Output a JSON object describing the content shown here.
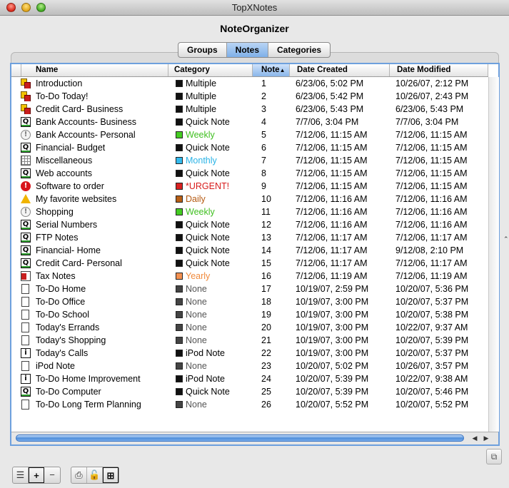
{
  "window": {
    "title": "TopXNotes"
  },
  "app": {
    "title": "NoteOrganizer"
  },
  "tabs": [
    {
      "label": "Groups",
      "active": false
    },
    {
      "label": "Notes",
      "active": true
    },
    {
      "label": "Categories",
      "active": false
    }
  ],
  "table": {
    "columns": {
      "name": "Name",
      "category": "Category",
      "note": "Note",
      "created": "Date Created",
      "modified": "Date Modified"
    },
    "sort_indicator": "▲",
    "rows": [
      {
        "icon": "multi-icon",
        "name": "Introduction",
        "category": "Multiple",
        "cat_color": "#000000",
        "swatch": "#111111",
        "note": "1",
        "created": "6/23/06, 5:02 PM",
        "modified": "10/26/07, 2:12 PM"
      },
      {
        "icon": "multi-icon",
        "name": "To-Do Today!",
        "category": "Multiple",
        "cat_color": "#000000",
        "swatch": "#111111",
        "note": "2",
        "created": "6/23/06, 5:42 PM",
        "modified": "10/26/07, 2:43 PM"
      },
      {
        "icon": "multi-icon",
        "name": "Credit Card- Business",
        "category": "Multiple",
        "cat_color": "#000000",
        "swatch": "#111111",
        "note": "3",
        "created": "6/23/06, 5:43 PM",
        "modified": "6/23/06, 5:43 PM"
      },
      {
        "icon": "quick-note-icon",
        "name": "Bank Accounts- Business",
        "category": "Quick Note",
        "cat_color": "#000000",
        "swatch": "#111111",
        "note": "4",
        "created": "7/7/06, 3:04 PM",
        "modified": "7/7/06, 3:04 PM"
      },
      {
        "icon": "weekly-alert-icon",
        "name": "Bank Accounts- Personal",
        "category": "Weekly",
        "cat_color": "#3fbf1f",
        "swatch": "#44cc22",
        "note": "5",
        "created": "7/12/06, 11:15 AM",
        "modified": "7/12/06, 11:15 AM"
      },
      {
        "icon": "quick-note-icon",
        "name": "Financial- Budget",
        "category": "Quick Note",
        "cat_color": "#000000",
        "swatch": "#111111",
        "note": "6",
        "created": "7/12/06, 11:15 AM",
        "modified": "7/12/06, 11:15 AM"
      },
      {
        "icon": "grid-icon",
        "name": "Miscellaneous",
        "category": "Monthly",
        "cat_color": "#2ab3e6",
        "swatch": "#33bbee",
        "note": "7",
        "created": "7/12/06, 11:15 AM",
        "modified": "7/12/06, 11:15 AM"
      },
      {
        "icon": "quick-note-icon",
        "name": "Web accounts",
        "category": "Quick Note",
        "cat_color": "#000000",
        "swatch": "#111111",
        "note": "8",
        "created": "7/12/06, 11:15 AM",
        "modified": "7/12/06, 11:15 AM"
      },
      {
        "icon": "urgent-icon",
        "name": "Software to order",
        "category": "*URGENT!",
        "cat_color": "#d81b1b",
        "swatch": "#d82020",
        "note": "9",
        "created": "7/12/06, 11:15 AM",
        "modified": "7/12/06, 11:15 AM"
      },
      {
        "icon": "warning-icon",
        "name": "My favorite websites",
        "category": "Daily",
        "cat_color": "#b55a12",
        "swatch": "#b85f15",
        "note": "10",
        "created": "7/12/06, 11:16 AM",
        "modified": "7/12/06, 11:16 AM"
      },
      {
        "icon": "weekly-alert-icon",
        "name": "Shopping",
        "category": "Weekly",
        "cat_color": "#3fbf1f",
        "swatch": "#44cc22",
        "note": "11",
        "created": "7/12/06, 11:16 AM",
        "modified": "7/12/06, 11:16 AM"
      },
      {
        "icon": "quick-note-icon",
        "name": "Serial Numbers",
        "category": "Quick Note",
        "cat_color": "#000000",
        "swatch": "#111111",
        "note": "12",
        "created": "7/12/06, 11:16 AM",
        "modified": "7/12/06, 11:16 AM"
      },
      {
        "icon": "quick-note-icon",
        "name": "FTP Notes",
        "category": "Quick Note",
        "cat_color": "#000000",
        "swatch": "#111111",
        "note": "13",
        "created": "7/12/06, 11:17 AM",
        "modified": "7/12/06, 11:17 AM"
      },
      {
        "icon": "quick-note-icon",
        "name": "Financial- Home",
        "category": "Quick Note",
        "cat_color": "#000000",
        "swatch": "#111111",
        "note": "14",
        "created": "7/12/06, 11:17 AM",
        "modified": "9/12/08, 2:10 PM"
      },
      {
        "icon": "quick-note-icon",
        "name": "Credit Card- Personal",
        "category": "Quick Note",
        "cat_color": "#000000",
        "swatch": "#111111",
        "note": "15",
        "created": "7/12/06, 11:17 AM",
        "modified": "7/12/06, 11:17 AM"
      },
      {
        "icon": "tax-icon",
        "name": "Tax Notes",
        "category": "Yearly",
        "cat_color": "#f08a3c",
        "swatch": "#f39050",
        "note": "16",
        "created": "7/12/06, 11:19 AM",
        "modified": "7/12/06, 11:19 AM"
      },
      {
        "icon": "document-icon",
        "name": "To-Do Home",
        "category": "None",
        "cat_color": "#555555",
        "swatch": "#444444",
        "note": "17",
        "created": "10/19/07, 2:59 PM",
        "modified": "10/20/07, 5:36 PM"
      },
      {
        "icon": "document-icon",
        "name": "To-Do Office",
        "category": "None",
        "cat_color": "#555555",
        "swatch": "#444444",
        "note": "18",
        "created": "10/19/07, 3:00 PM",
        "modified": "10/20/07, 5:37 PM"
      },
      {
        "icon": "document-icon",
        "name": "To-Do School",
        "category": "None",
        "cat_color": "#555555",
        "swatch": "#444444",
        "note": "19",
        "created": "10/19/07, 3:00 PM",
        "modified": "10/20/07, 5:38 PM"
      },
      {
        "icon": "document-icon",
        "name": "Today's Errands",
        "category": "None",
        "cat_color": "#555555",
        "swatch": "#444444",
        "note": "20",
        "created": "10/19/07, 3:00 PM",
        "modified": "10/22/07, 9:37 AM"
      },
      {
        "icon": "document-icon",
        "name": "Today's Shopping",
        "category": "None",
        "cat_color": "#555555",
        "swatch": "#444444",
        "note": "21",
        "created": "10/19/07, 3:00 PM",
        "modified": "10/20/07, 5:39 PM"
      },
      {
        "icon": "ipod-note-icon",
        "name": "Today's Calls",
        "category": "iPod Note",
        "cat_color": "#000000",
        "swatch": "#111111",
        "note": "22",
        "created": "10/19/07, 3:00 PM",
        "modified": "10/20/07, 5:37 PM"
      },
      {
        "icon": "document-icon",
        "name": "iPod Note",
        "category": "None",
        "cat_color": "#555555",
        "swatch": "#444444",
        "note": "23",
        "created": "10/20/07, 5:02 PM",
        "modified": "10/26/07, 3:57 PM"
      },
      {
        "icon": "ipod-note-icon",
        "name": "To-Do Home Improvement",
        "category": "iPod Note",
        "cat_color": "#000000",
        "swatch": "#111111",
        "note": "24",
        "created": "10/20/07, 5:39 PM",
        "modified": "10/22/07, 9:38 AM"
      },
      {
        "icon": "quick-note-icon",
        "name": "To-Do Computer",
        "category": "Quick Note",
        "cat_color": "#000000",
        "swatch": "#111111",
        "note": "25",
        "created": "10/20/07, 5:39 PM",
        "modified": "10/20/07, 5:46 PM"
      },
      {
        "icon": "document-icon",
        "name": "To-Do Long Term Planning",
        "category": "None",
        "cat_color": "#555555",
        "swatch": "#444444",
        "note": "26",
        "created": "10/20/07, 5:52 PM",
        "modified": "10/20/07, 5:52 PM"
      }
    ]
  },
  "colors": {
    "selection_border": "#6ea0dd",
    "scroll_thumb": "#4f8fdb"
  },
  "toolbar": {
    "buttons": [
      "list-view-icon",
      "add-icon",
      "remove-icon",
      "print-icon",
      "lock-icon",
      "add-note-icon"
    ]
  }
}
